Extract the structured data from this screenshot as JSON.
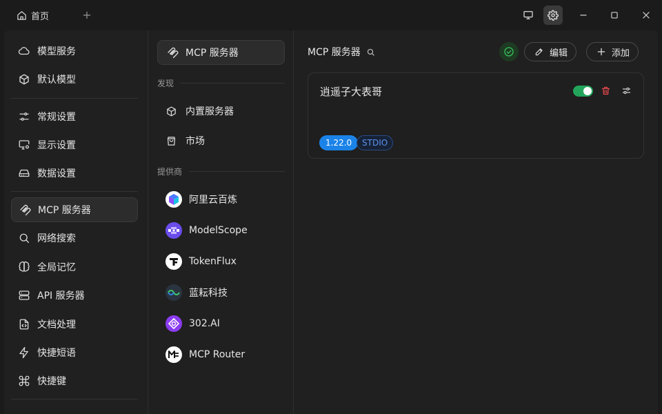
{
  "titlebar": {
    "tab_home_label": "首页",
    "icons": [
      "home-icon",
      "plus-icon",
      "monitor-icon",
      "gear-icon",
      "minimize-icon",
      "maximize-icon",
      "close-icon"
    ]
  },
  "sidebar": {
    "items": [
      {
        "label": "模型服务",
        "icon": "cloud-icon"
      },
      {
        "label": "默认模型",
        "icon": "cube-icon"
      },
      {
        "label": "常规设置",
        "icon": "sliders-icon"
      },
      {
        "label": "显示设置",
        "icon": "monitor-settings-icon"
      },
      {
        "label": "数据设置",
        "icon": "hard-drive-icon"
      },
      {
        "label": "MCP 服务器",
        "icon": "mcp-icon",
        "active": true
      },
      {
        "label": "网络搜索",
        "icon": "search-icon"
      },
      {
        "label": "全局记忆",
        "icon": "brain-icon"
      },
      {
        "label": "API 服务器",
        "icon": "server-icon"
      },
      {
        "label": "文档处理",
        "icon": "file-code-icon"
      },
      {
        "label": "快捷短语",
        "icon": "zap-icon"
      },
      {
        "label": "快捷键",
        "icon": "command-icon"
      }
    ]
  },
  "middle": {
    "header_label": "MCP 服务器",
    "discover_label": "发现",
    "discover_items": [
      {
        "label": "内置服务器",
        "icon": "cube-icon"
      },
      {
        "label": "市场",
        "icon": "shopping-bag-icon"
      }
    ],
    "providers_label": "提供商",
    "providers": [
      {
        "label": "阿里云百炼",
        "icon": "bailian-logo-icon"
      },
      {
        "label": "ModelScope",
        "icon": "modelscope-logo-icon"
      },
      {
        "label": "TokenFlux",
        "icon": "tokenflux-logo-icon"
      },
      {
        "label": "蓝耘科技",
        "icon": "lanyun-logo-icon"
      },
      {
        "label": "302.AI",
        "icon": "302ai-logo-icon"
      },
      {
        "label": "MCP Router",
        "icon": "mcp-router-logo-icon"
      }
    ]
  },
  "content": {
    "title": "MCP 服务器",
    "edit_label": "编辑",
    "add_label": "添加",
    "status_color": "#22a55b",
    "servers": [
      {
        "name": "逍遥子大表哥",
        "version": "1.22.0",
        "type": "STDIO",
        "enabled": true
      }
    ]
  },
  "colors": {
    "accent_blue": "#1b83e8",
    "toggle_on": "#22a55b",
    "delete_red": "#e5484d",
    "background": "#1b1b1b",
    "panel": "#202020"
  }
}
